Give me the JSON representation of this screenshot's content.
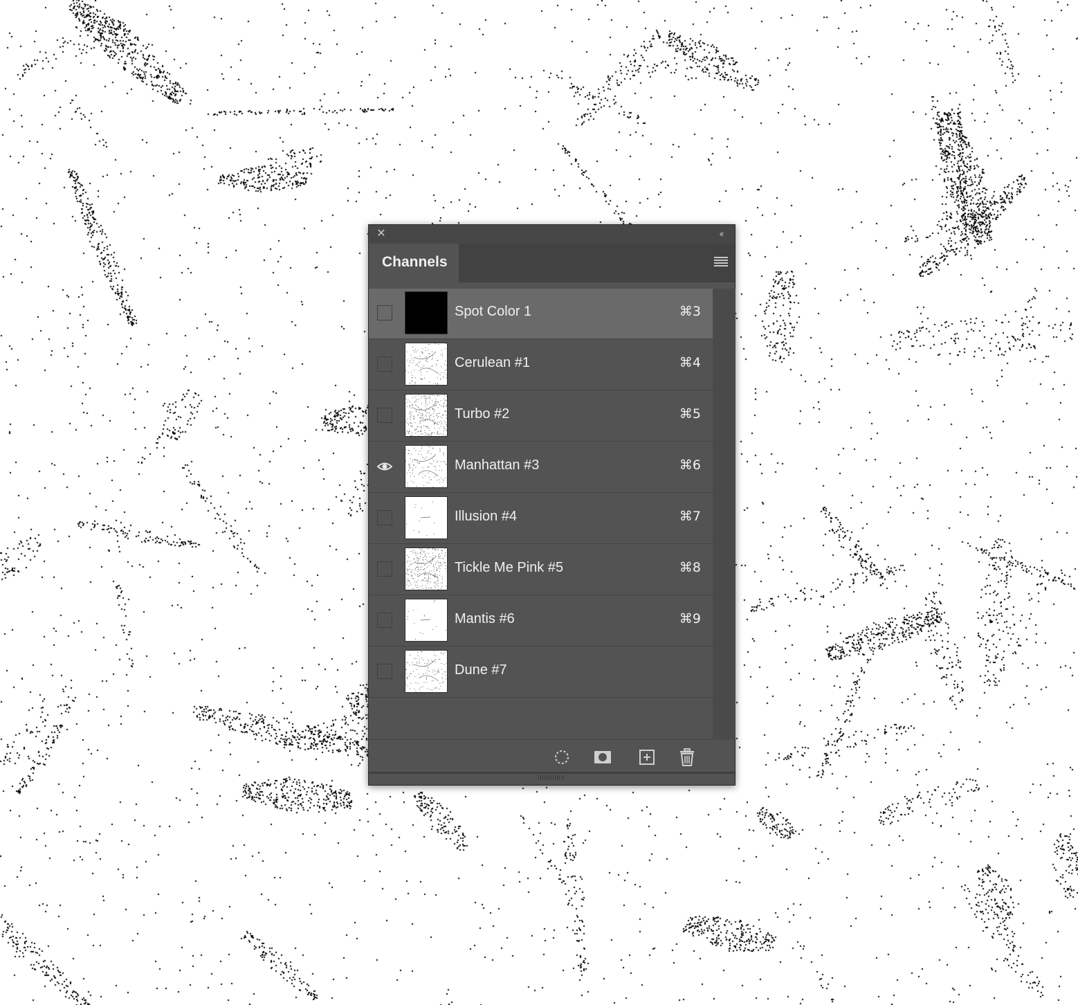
{
  "panel": {
    "tab_label": "Channels",
    "close_glyph": "✕",
    "collapse_glyph": "‹‹"
  },
  "channels": [
    {
      "name": "Spot Color 1",
      "shortcut": "⌘3",
      "visible": false,
      "selected": true,
      "thumb": "black"
    },
    {
      "name": "Cerulean #1",
      "shortcut": "⌘4",
      "visible": false,
      "selected": false,
      "thumb": "sketch"
    },
    {
      "name": "Turbo #2",
      "shortcut": "⌘5",
      "visible": false,
      "selected": false,
      "thumb": "dense"
    },
    {
      "name": "Manhattan #3",
      "shortcut": "⌘6",
      "visible": true,
      "selected": false,
      "thumb": "sketch"
    },
    {
      "name": "Illusion #4",
      "shortcut": "⌘7",
      "visible": false,
      "selected": false,
      "thumb": "light"
    },
    {
      "name": "Tickle Me Pink #5",
      "shortcut": "⌘8",
      "visible": false,
      "selected": false,
      "thumb": "dense"
    },
    {
      "name": "Mantis #6",
      "shortcut": "⌘9",
      "visible": false,
      "selected": false,
      "thumb": "light"
    },
    {
      "name": "Dune #7",
      "shortcut": "",
      "visible": false,
      "selected": false,
      "thumb": "sketch"
    }
  ],
  "footer_icons": [
    "load-selection-icon",
    "save-selection-icon",
    "new-channel-icon",
    "trash-icon"
  ],
  "colors": {
    "panel_bg": "#535353",
    "selected_row": "#6a6a6a",
    "text": "#f0f0f0",
    "canvas": "#ffffff",
    "stipple": "#000000"
  }
}
